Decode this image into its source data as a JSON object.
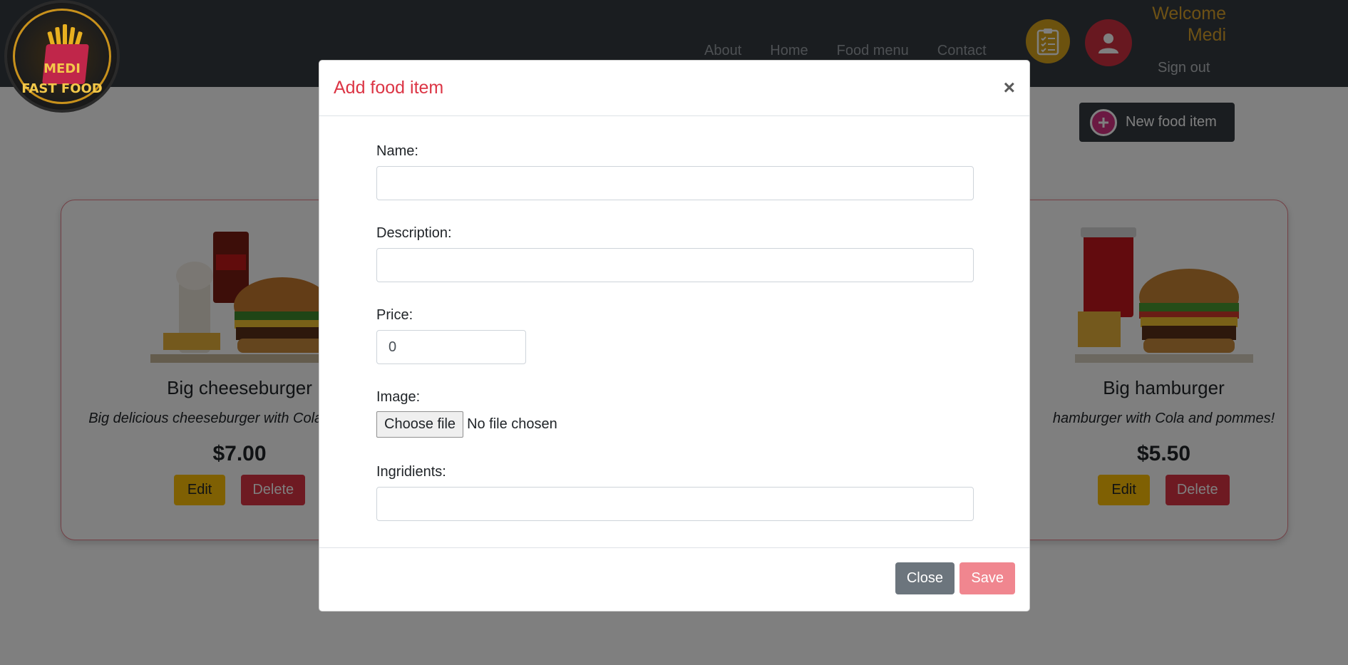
{
  "logo": {
    "line1": "MEDI",
    "line2": "FAST FOOD"
  },
  "nav": {
    "links": [
      "About",
      "Home",
      "Food menu",
      "Contact"
    ],
    "welcome": "Welcome Medi",
    "signout": "Sign out",
    "menu_icon": "clipboard-checklist-icon",
    "user_icon": "user-icon"
  },
  "toolbar": {
    "new_item_label": "New food item"
  },
  "food_items": [
    {
      "title": "Big cheeseburger",
      "description": "Big delicious cheeseburger with Cola and frape!",
      "price": "$7.00",
      "edit_label": "Edit",
      "delete_label": "Delete"
    },
    {
      "title": "Big hamburger",
      "description": "hamburger with Cola and pommes!",
      "price": "$5.50",
      "edit_label": "Edit",
      "delete_label": "Delete"
    }
  ],
  "modal": {
    "title": "Add food item",
    "close_x": "×",
    "fields": {
      "name_label": "Name:",
      "name_value": "",
      "description_label": "Description:",
      "description_value": "",
      "price_label": "Price:",
      "price_value": "0",
      "image_label": "Image:",
      "file_button": "Choose file",
      "file_status": "No file chosen",
      "ingredients_label": "Ingridients:",
      "ingredients_value": ""
    },
    "close_label": "Close",
    "save_label": "Save"
  },
  "colors": {
    "navbar": "#343a40",
    "accent_red": "#dc3545",
    "accent_yellow": "#ffc107",
    "welcome": "#dba22a"
  }
}
